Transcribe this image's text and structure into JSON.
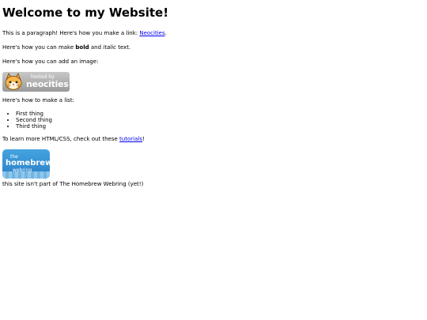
{
  "page": {
    "title": "Welcome to my Website!",
    "paragraph_intro": "This is a paragraph! Here's how you make a link: ",
    "link_neocities": "Neocities",
    "paragraph_intro_end": ".",
    "bold_prefix": "Here's how you can make ",
    "bold_word": "bold",
    "bold_middle": " and ",
    "italic_word": "italic",
    "bold_suffix": " text.",
    "image_intro": "Here's how you can add an image:",
    "badge": {
      "small": "hosted by",
      "big": "neocities"
    },
    "list_intro": "Here's how to make a list:",
    "list_items": [
      "First thing",
      "Second thing",
      "Third thing"
    ],
    "learn_prefix": "To learn more HTML/CSS, check out these ",
    "tutorials_link": "tutorials",
    "learn_suffix": "!",
    "webring_badge": {
      "line1": "the",
      "line2": "homebrew",
      "line3": "webring"
    },
    "webring_note": "this site isn't part of The Homebrew Webring (yet!)"
  },
  "colors": {
    "link": "#0000ee",
    "webring_bg": "#2a7fc6",
    "badge_bg": "#a0a0a0"
  },
  "icons": {
    "badge_mascot": "cat-icon"
  }
}
